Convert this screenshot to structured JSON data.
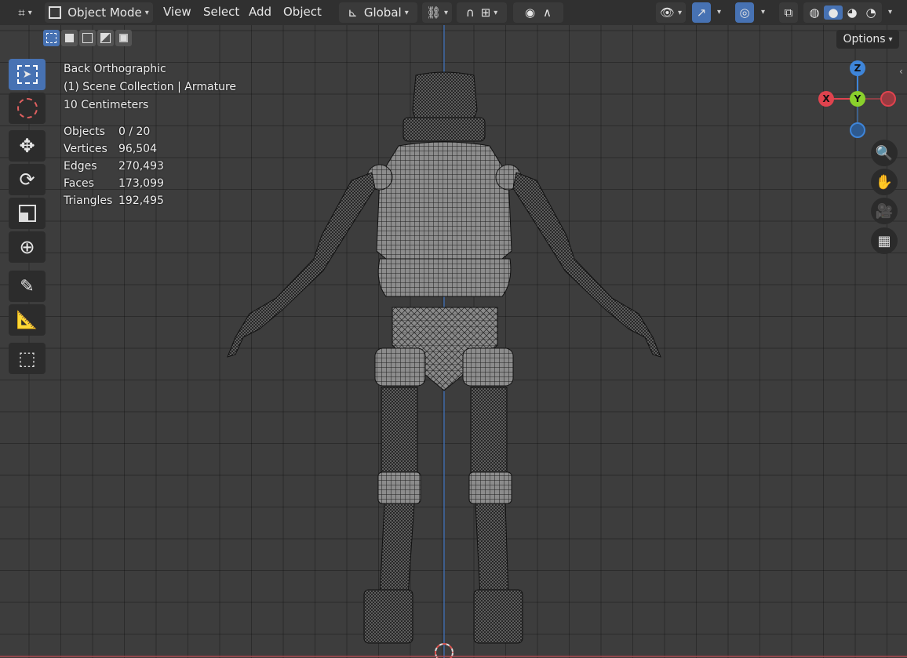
{
  "header": {
    "mode_label": "Object Mode",
    "menus": [
      "View",
      "Select",
      "Add",
      "Object"
    ],
    "transform_orientation": "Global",
    "options_label": "Options"
  },
  "viewport_info": {
    "view_name": "Back Orthographic",
    "collection": "(1) Scene Collection | Armature",
    "grid_scale": "10 Centimeters"
  },
  "stats": [
    {
      "key": "Objects",
      "value": "0 / 20"
    },
    {
      "key": "Vertices",
      "value": "96,504"
    },
    {
      "key": "Edges",
      "value": "270,493"
    },
    {
      "key": "Faces",
      "value": "173,099"
    },
    {
      "key": "Triangles",
      "value": "192,495"
    }
  ],
  "gizmo": {
    "z": "Z",
    "y": "Y",
    "x": "X"
  },
  "tools": [
    "select-box",
    "cursor",
    "move",
    "rotate",
    "scale",
    "transform",
    "annotate",
    "measure",
    "add-cube"
  ],
  "colors": {
    "accent": "#4772b3",
    "x_axis": "#e0434e",
    "y_axis": "#8ad02c",
    "z_axis": "#3e85d9"
  }
}
